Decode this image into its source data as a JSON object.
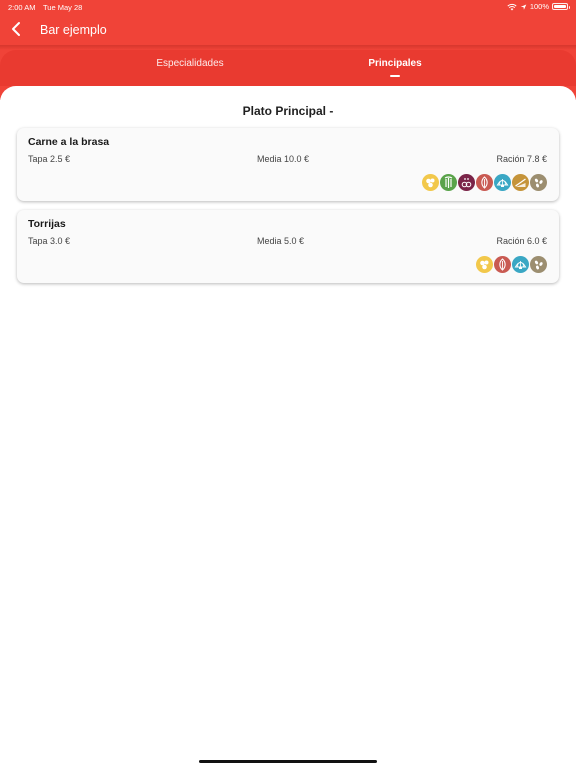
{
  "status_bar": {
    "time": "2:00 AM",
    "date": "Tue May 28",
    "battery": "100%",
    "battery_level": 1.0
  },
  "nav": {
    "title": "Bar ejemplo",
    "back_icon": "chevron-left-icon"
  },
  "tabs": [
    {
      "label": "Especialidades",
      "selected": false
    },
    {
      "label": "Principales",
      "selected": true
    }
  ],
  "section": {
    "title": "Plato Principal -"
  },
  "dishes": [
    {
      "name": "Carne a la brasa",
      "tapa": "Tapa 2.5 €",
      "media": "Media 10.0 €",
      "racion": "Ración 7.8 €",
      "allergens": [
        {
          "icon": "eggs-icon",
          "color": "#f2c84b"
        },
        {
          "icon": "celery-icon",
          "color": "#5aa34a"
        },
        {
          "icon": "sulphites-icon",
          "color": "#7a2448"
        },
        {
          "icon": "lupin-icon",
          "color": "#c95a52"
        },
        {
          "icon": "molluscs-icon",
          "color": "#3aa7c4"
        },
        {
          "icon": "gluten-icon",
          "color": "#c5943a"
        },
        {
          "icon": "sesame-icon",
          "color": "#9c8e70"
        }
      ]
    },
    {
      "name": "Torrijas",
      "tapa": "Tapa 3.0 €",
      "media": "Media 5.0 €",
      "racion": "Ración 6.0 €",
      "allergens": [
        {
          "icon": "eggs-icon",
          "color": "#f2c84b"
        },
        {
          "icon": "lupin-icon",
          "color": "#c95a52"
        },
        {
          "icon": "molluscs-icon",
          "color": "#3aa7c4"
        },
        {
          "icon": "sesame-icon",
          "color": "#9c8e70"
        }
      ]
    }
  ],
  "colors": {
    "primary": "#f04338",
    "tab_bar": "#e93a30"
  }
}
